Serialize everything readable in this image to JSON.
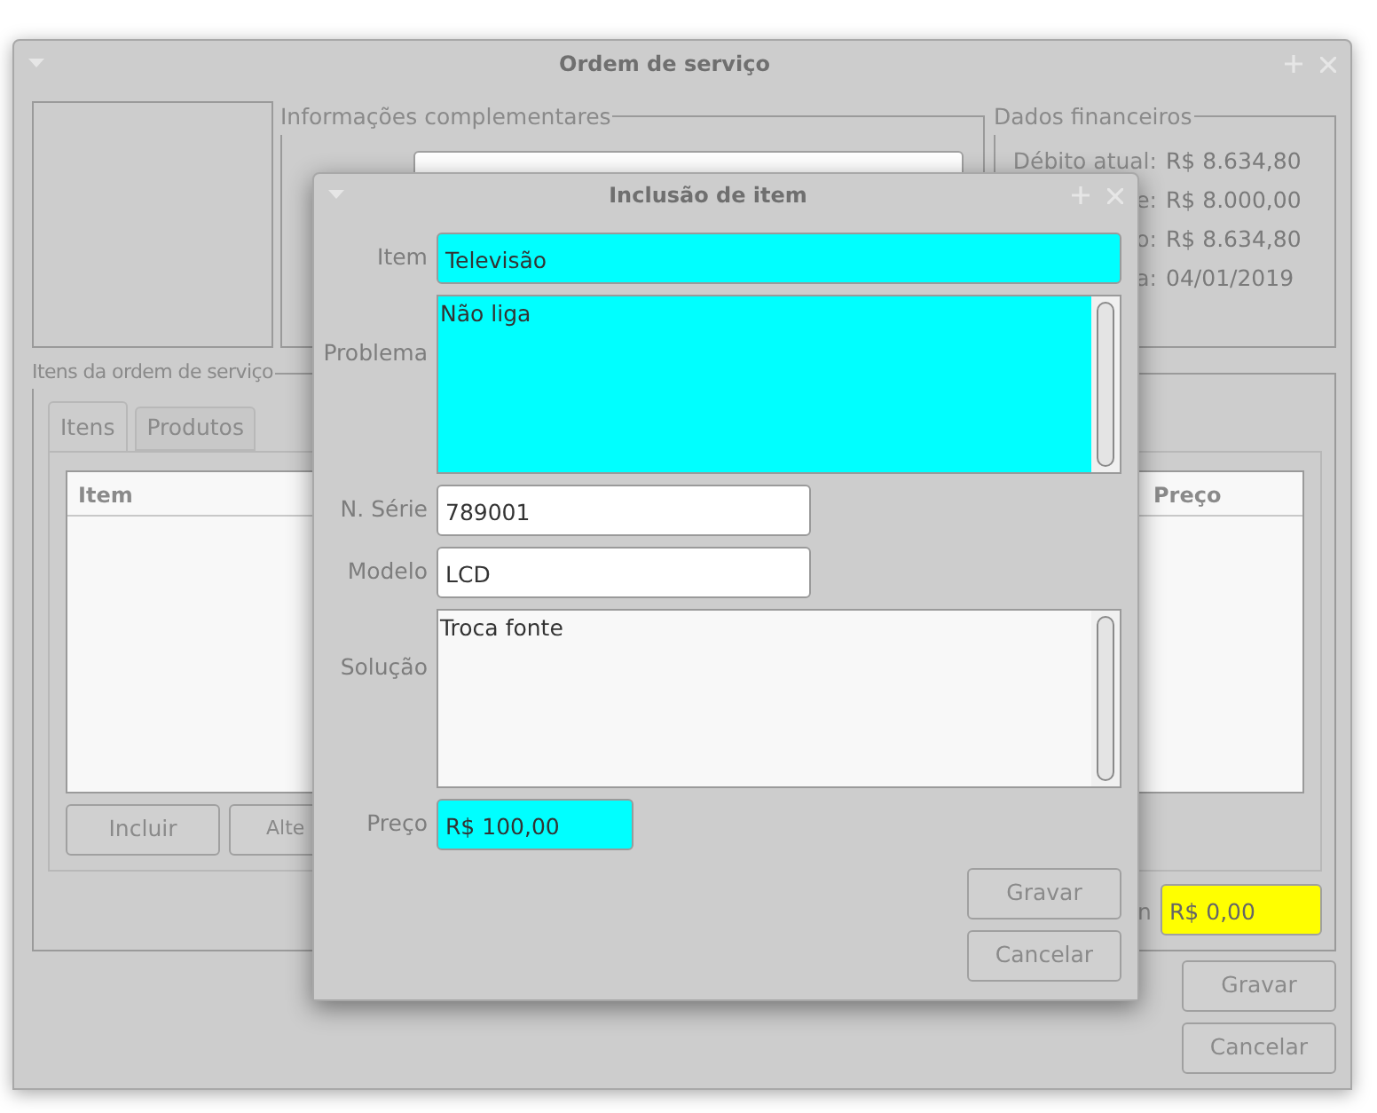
{
  "main_window": {
    "title": "Ordem de serviço",
    "complementary_info": {
      "title": "Informações complementares"
    },
    "financial": {
      "title": "Dados financeiros",
      "rows": [
        {
          "label": "Débito atual:",
          "value": "R$ 8.634,80"
        },
        {
          "label": "e:",
          "value": "R$ 8.000,00"
        },
        {
          "label": "o:",
          "value": "R$ 8.634,80"
        },
        {
          "label": "a:",
          "value": "04/01/2019"
        }
      ]
    },
    "items_group": {
      "title": "Itens da ordem de serviço",
      "tabs": [
        {
          "label": "Itens",
          "selected": true
        },
        {
          "label": "Produtos",
          "selected": false
        }
      ],
      "table": {
        "columns": [
          "Item",
          "Preço"
        ]
      },
      "buttons": [
        "Incluir",
        "Alte"
      ],
      "total_label": "n",
      "total_value": "R$ 0,00"
    },
    "buttons": [
      "Gravar",
      "Cancelar"
    ]
  },
  "dialog": {
    "title": "Inclusão de item",
    "fields": [
      {
        "kind": "line",
        "label": "Item",
        "value": "Televisão",
        "required": true,
        "wide": true
      },
      {
        "kind": "text",
        "label": "Problema",
        "value": "Não liga",
        "required": true
      },
      {
        "kind": "line",
        "label": "N. Série",
        "value": "789001",
        "required": false,
        "wide": false
      },
      {
        "kind": "line",
        "label": "Modelo",
        "value": "LCD",
        "required": false,
        "wide": false
      },
      {
        "kind": "text",
        "label": "Solução",
        "value": "Troca fonte",
        "required": false
      },
      {
        "kind": "price",
        "label": "Preço",
        "value": "R$ 100,00",
        "required": true
      }
    ],
    "buttons": [
      "Gravar",
      "Cancelar"
    ]
  }
}
